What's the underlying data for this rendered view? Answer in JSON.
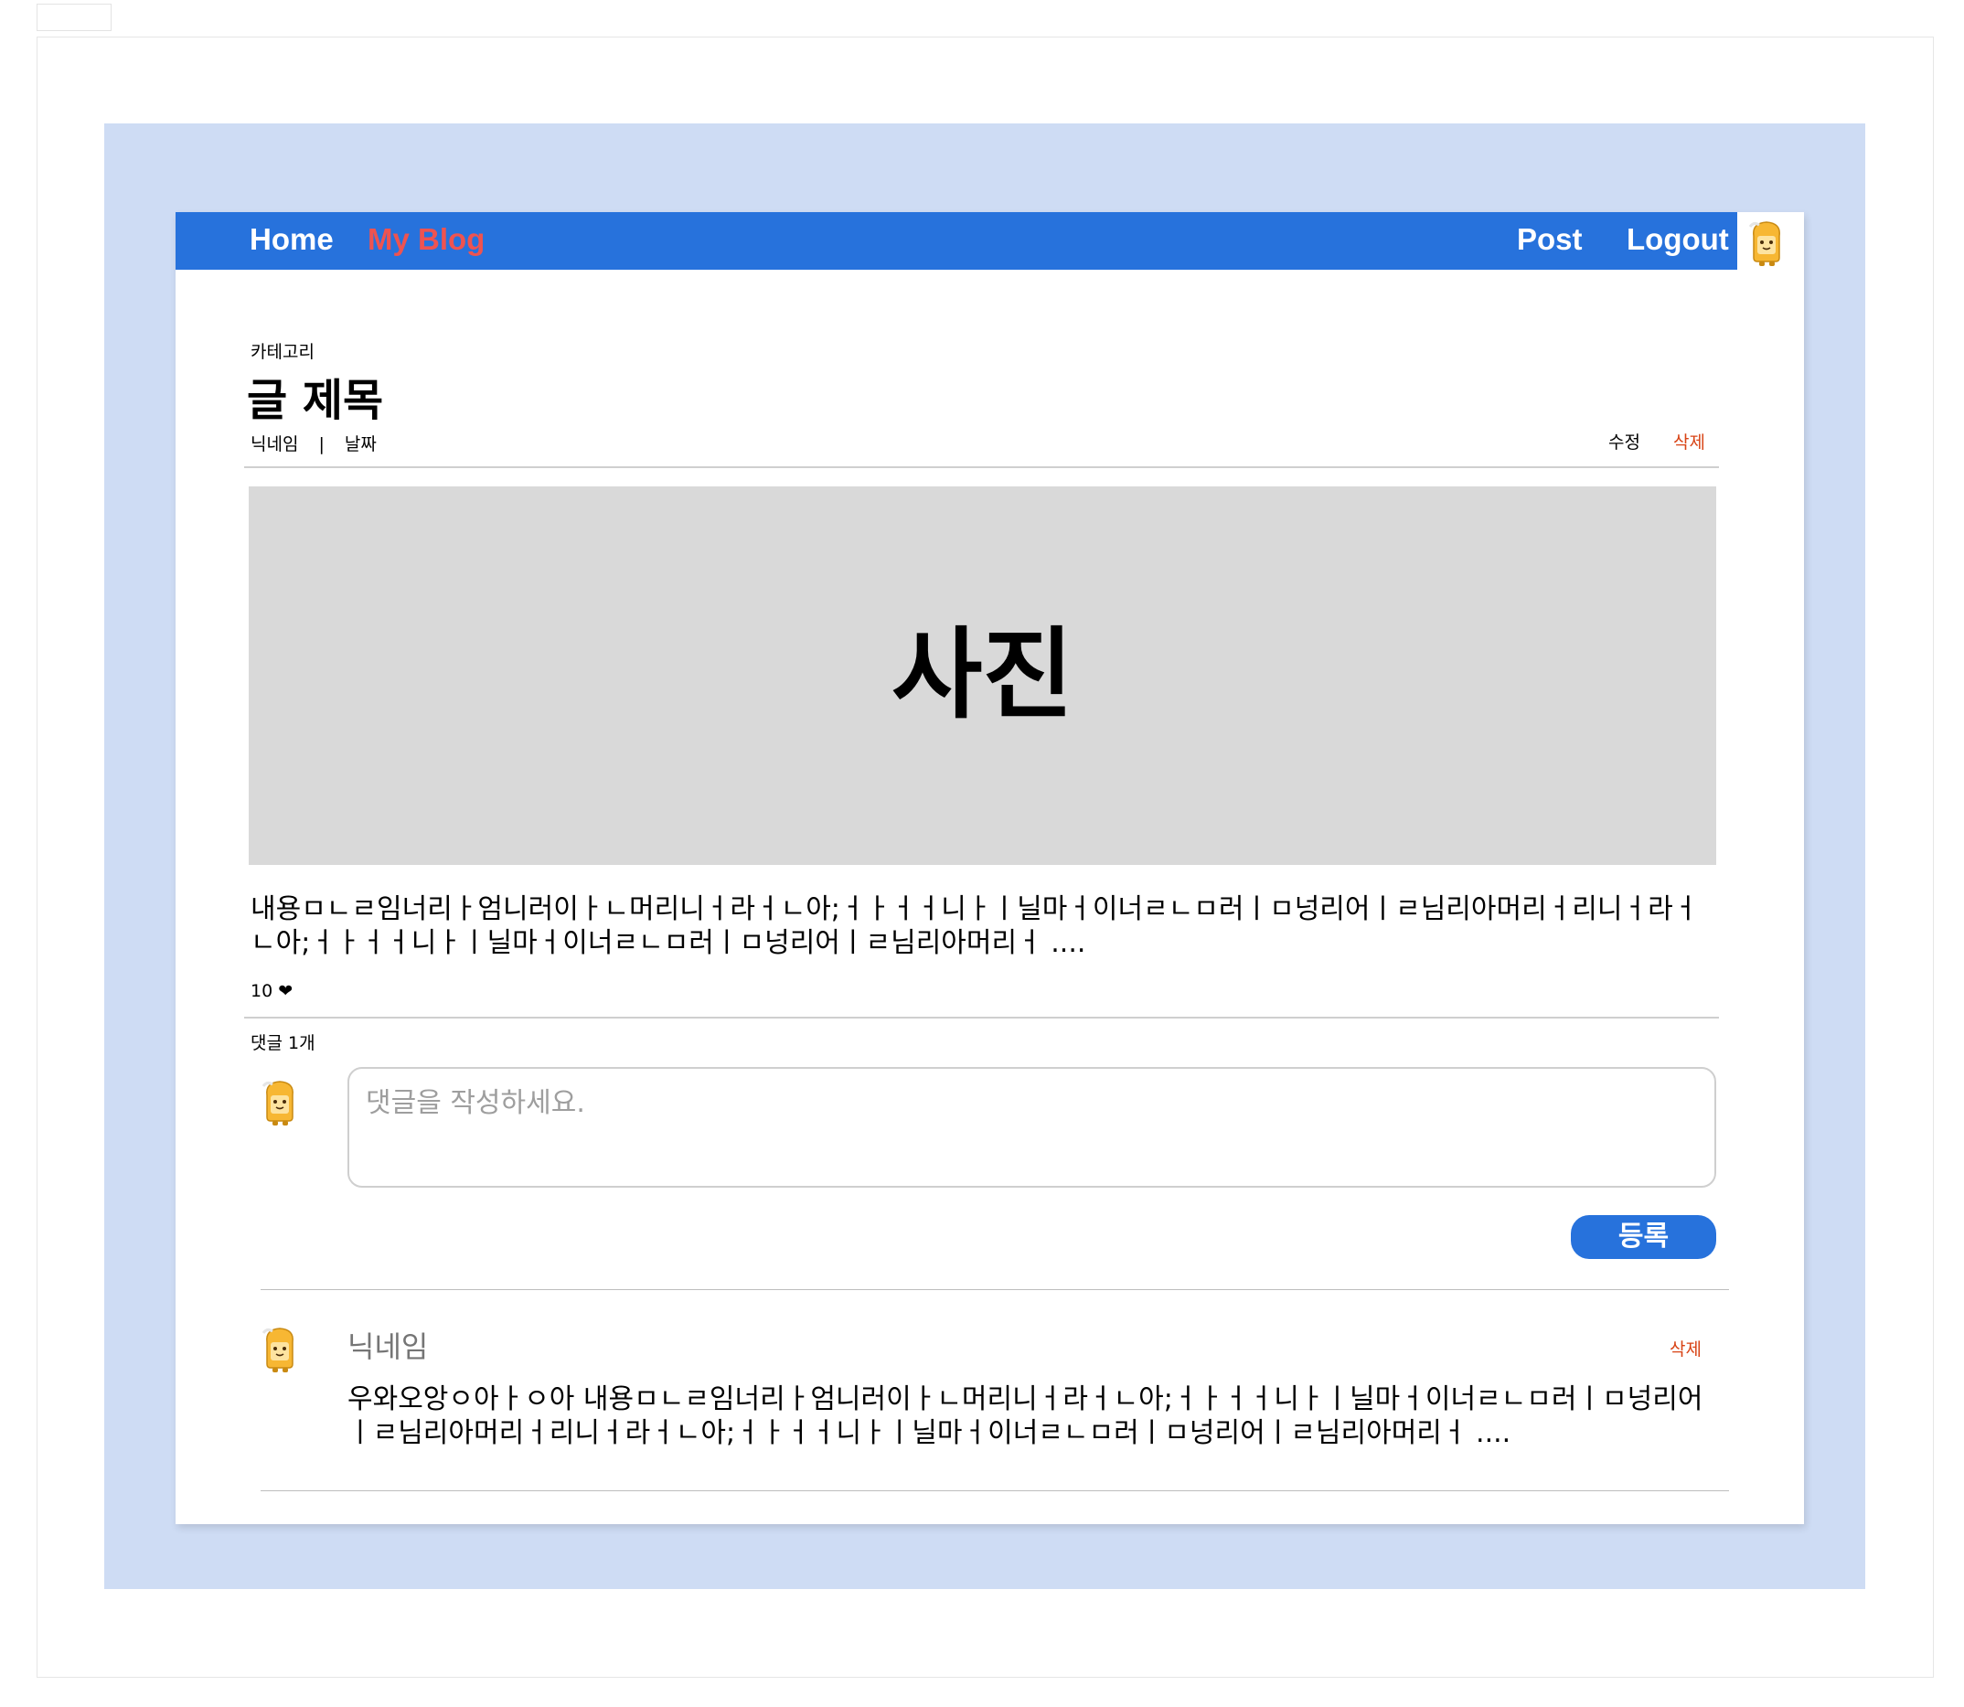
{
  "nav": {
    "home": "Home",
    "my_blog": "My Blog",
    "post": "Post",
    "logout": "Logout"
  },
  "post": {
    "category": "카테고리",
    "title": "글 제목",
    "nickname": "닉네임",
    "separator": "|",
    "date": "날짜",
    "edit": "수정",
    "delete": "삭제",
    "photo_label": "사진",
    "content": "내용ㅁㄴㄹ임너리ㅏ엄니러이ㅏㄴ머리니ㅓ라ㅓㄴ아;ㅓㅏㅓㅓ니ㅏㅣ닐마ㅓ이너ㄹㄴㅁ러ㅣㅁ넝리어ㅣㄹ님리아머리ㅓ리니ㅓ라ㅓㄴ아;ㅓㅏㅓㅓ니ㅏㅣ닐마ㅓ이너ㄹㄴㅁ러ㅣㅁ넝리어ㅣㄹ님리아머리ㅓ ....",
    "likes": "10",
    "heart_icon": "heart-icon"
  },
  "comments": {
    "count_label": "댓글 1개",
    "placeholder": "댓글을 작성하세요.",
    "submit_label": "등록",
    "items": [
      {
        "nickname": "닉네임",
        "delete": "삭제",
        "text": "우와오앙ㅇ아ㅏㅇ아 내용ㅁㄴㄹ임너리ㅏ엄니러이ㅏㄴ머리니ㅓ라ㅓㄴ아;ㅓㅏㅓㅓ니ㅏㅣ닐마ㅓ이너ㄹㄴㅁ러ㅣㅁ넝리어ㅣㄹ님리아머리ㅓ리니ㅓ라ㅓㄴ아;ㅓㅏㅓㅓ니ㅏㅣ닐마ㅓ이너ㄹㄴㅁ러ㅣㅁ넝리어ㅣㄹ님리아머리ㅓ ...."
      }
    ]
  },
  "colors": {
    "nav_bg": "#2772dc",
    "accent_red": "#ef5350",
    "delete_red": "#d84315",
    "backdrop": "#cedcf4",
    "photo_bg": "#d9d9d9"
  }
}
